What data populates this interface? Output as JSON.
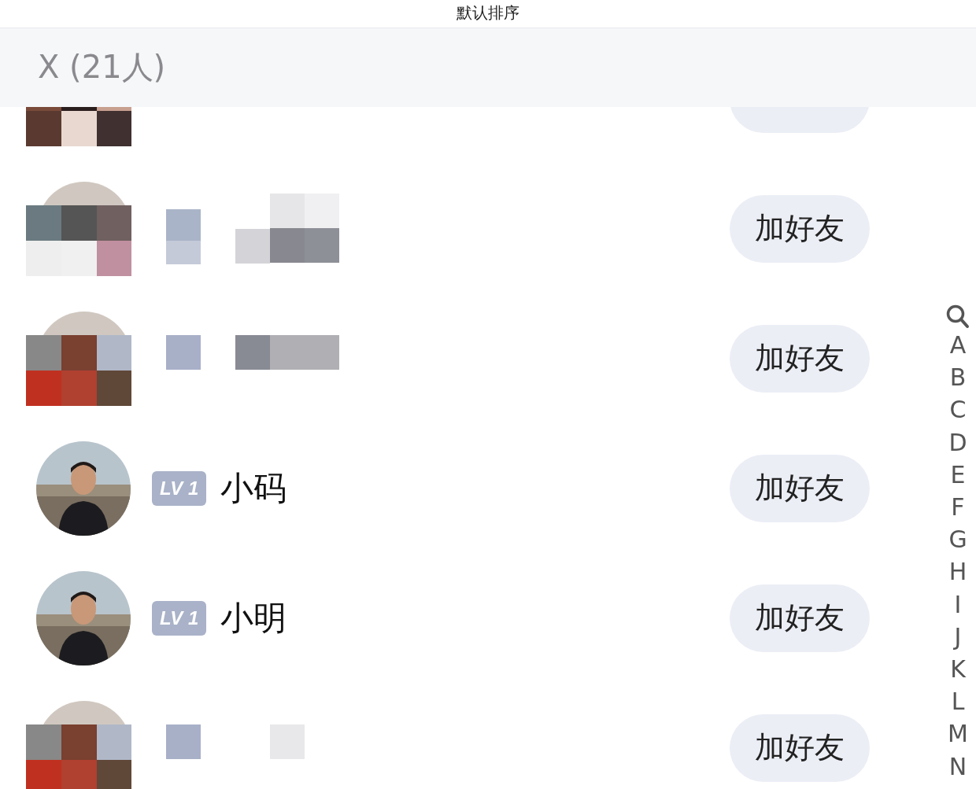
{
  "top_bar": {
    "title": "默认排序"
  },
  "section": {
    "title": "X (21人)"
  },
  "rows": [
    {
      "kind": "partial"
    },
    {
      "kind": "redacted",
      "button": "加好友"
    },
    {
      "kind": "redacted",
      "button": "加好友"
    },
    {
      "kind": "named",
      "badge": "LV 1",
      "name": "小码",
      "button": "加好友"
    },
    {
      "kind": "named",
      "badge": "LV 1",
      "name": "小明",
      "button": "加好友"
    },
    {
      "kind": "redacted",
      "button": "加好友"
    }
  ],
  "index_bar": [
    "A",
    "B",
    "C",
    "D",
    "E",
    "F",
    "G",
    "H",
    "I",
    "J",
    "K",
    "L",
    "M",
    "N"
  ]
}
